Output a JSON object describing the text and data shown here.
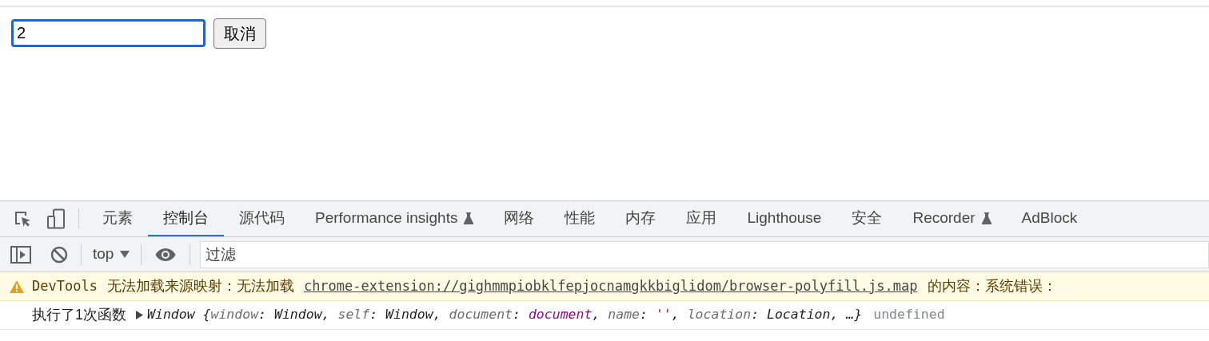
{
  "page": {
    "input": {
      "value": "2",
      "focused": true
    },
    "button": "取消"
  },
  "devtools": {
    "tabs": [
      {
        "label": "元素",
        "selected": false,
        "experimental": false
      },
      {
        "label": "控制台",
        "selected": true,
        "experimental": false
      },
      {
        "label": "源代码",
        "selected": false,
        "experimental": false
      },
      {
        "label": "Performance insights",
        "selected": false,
        "experimental": true
      },
      {
        "label": "网络",
        "selected": false,
        "experimental": false
      },
      {
        "label": "性能",
        "selected": false,
        "experimental": false
      },
      {
        "label": "内存",
        "selected": false,
        "experimental": false
      },
      {
        "label": "应用",
        "selected": false,
        "experimental": false
      },
      {
        "label": "Lighthouse",
        "selected": false,
        "experimental": false
      },
      {
        "label": "安全",
        "selected": false,
        "experimental": false
      },
      {
        "label": "Recorder",
        "selected": false,
        "experimental": true
      },
      {
        "label": "AdBlock",
        "selected": false,
        "experimental": false
      }
    ],
    "toolbar": {
      "context": "top",
      "filter_placeholder": "过滤"
    },
    "messages": [
      {
        "kind": "warning",
        "source": "DevTools",
        "text": "无法加载来源映射：无法加载",
        "link": "chrome-extension://gighmmpiobklfepjocnamgkkbiglidom/browser-polyfill.js.map",
        "after": "的内容：系统错误："
      },
      {
        "kind": "log",
        "text": "执行了1次函数",
        "object": [
          {
            "kind": "value",
            "text": "Window {"
          },
          {
            "kind": "key",
            "text": "window"
          },
          {
            "kind": "value",
            "text": ": Window, "
          },
          {
            "kind": "key",
            "text": "self"
          },
          {
            "kind": "value",
            "text": ": Window, "
          },
          {
            "kind": "key",
            "text": "document"
          },
          {
            "kind": "value",
            "text": ": "
          },
          {
            "kind": "node",
            "text": "document"
          },
          {
            "kind": "value",
            "text": ", "
          },
          {
            "kind": "key",
            "text": "name"
          },
          {
            "kind": "value",
            "text": ": "
          },
          {
            "kind": "string",
            "text": "''"
          },
          {
            "kind": "value",
            "text": ", "
          },
          {
            "kind": "key",
            "text": "location"
          },
          {
            "kind": "value",
            "text": ": Location, …}"
          }
        ],
        "result": "undefined"
      }
    ]
  }
}
